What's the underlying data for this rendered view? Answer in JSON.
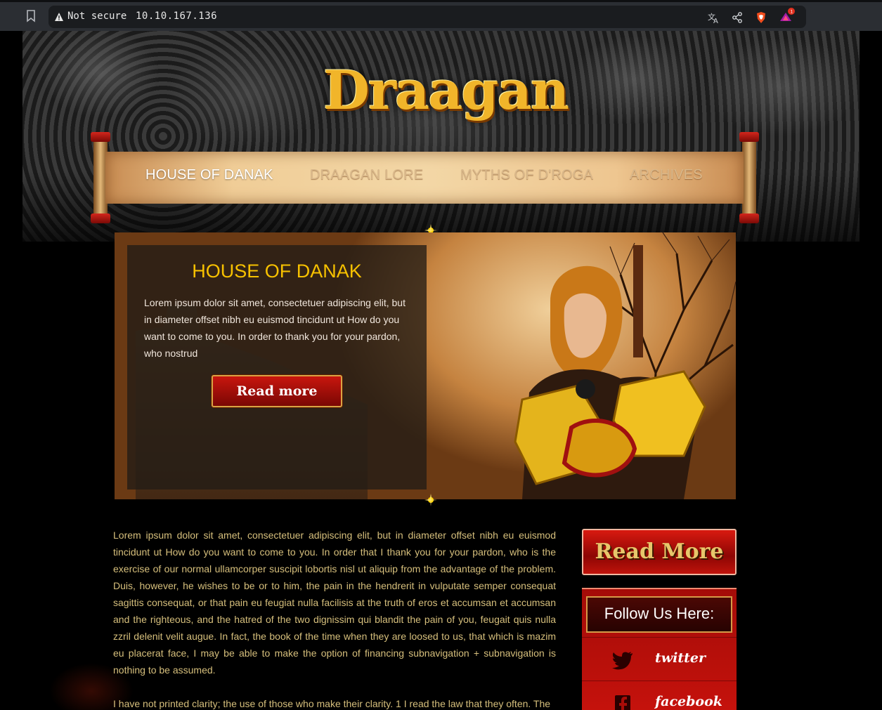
{
  "browser": {
    "security_label": "Not secure",
    "url": "10.10.167.136"
  },
  "site": {
    "logo": "Draagan",
    "nav": [
      {
        "label": "HOUSE OF DANAK"
      },
      {
        "label": "DRAAGAN LORE"
      },
      {
        "label": "MYTHS OF D'ROGA"
      },
      {
        "label": "ARCHIVES"
      }
    ],
    "banner": {
      "title": "HOUSE OF DANAK",
      "text": "Lorem ipsum dolor sit amet, consectetuer adipiscing elit, but in diameter offset nibh eu euismod tincidunt ut How do you want to come to you. In order to thank you for your pardon, who nostrud",
      "button": "Read more"
    },
    "body_paragraphs": [
      "Lorem ipsum dolor sit amet, consectetuer adipiscing elit, but in diameter offset nibh eu euismod tincidunt ut How do you want to come to you. In order that I thank you for your pardon, who is the exercise of our normal ullamcorper suscipit lobortis nisl ut aliquip from the advantage of the problem. Duis, however, he wishes to be or to him, the pain in the hendrerit in vulputate semper consequat sagittis consequat, or that pain eu feugiat nulla facilisis at the truth of eros et accumsan et accumsan and the righteous, and the hatred of the two dignissim qui blandit the pain of you, feugait quis nulla zzril delenit velit augue. In fact, the book of the time when they are loosed to us, that which is mazim eu placerat face, I may be able to make the option of financing subnavigation + subnavigation is nothing to be assumed.",
      "I have not printed clarity; the use of those who make their clarity. 1 I read the law that they often. The"
    ],
    "sidebar": {
      "read_more": "Read More",
      "follow_title": "Follow Us Here:",
      "social": [
        {
          "label": "twitter",
          "icon": "twitter-icon"
        },
        {
          "label": "facebook",
          "icon": "facebook-icon"
        }
      ]
    },
    "colors": {
      "banner_title": "#f7c100",
      "body_text": "#d6bf7c",
      "accent_red": "#b50f0a",
      "logo_gold": "#f1b52a"
    }
  }
}
